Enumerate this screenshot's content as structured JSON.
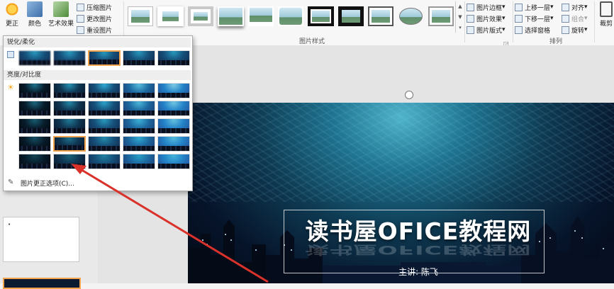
{
  "ribbon": {
    "adjust_buttons": [
      {
        "label": "更正",
        "icon": "sun-icon",
        "color": "#f5a623"
      },
      {
        "label": "颜色",
        "icon": "color-palette-icon",
        "color": "#4f81bd"
      },
      {
        "label": "艺术效果",
        "icon": "artistic-effects-icon",
        "color": "#6aa84f"
      }
    ],
    "adjust_small": [
      "压缩图片",
      "更改图片",
      "重设图片"
    ],
    "styles_group_label": "图片样式",
    "picture_commands": [
      "图片边框",
      "图片效果",
      "图片版式"
    ],
    "arrange_commands": [
      "上移一层",
      "下移一层",
      "选择窗格"
    ],
    "arrange_commands2": [
      "对齐",
      "组合",
      "旋转"
    ],
    "arrange_group_label": "排列",
    "size_label": "裁剪"
  },
  "dropdown": {
    "section1": "锐化/柔化",
    "section2": "亮度/对比度",
    "option_link": "图片更正选项(C)...",
    "selected_index": 16
  },
  "slide": {
    "title": "读书屋OFICE教程网",
    "author": "主讲: 陈飞"
  },
  "colors": {
    "arrow": "#d9322b",
    "selection": "#f2a34d"
  }
}
